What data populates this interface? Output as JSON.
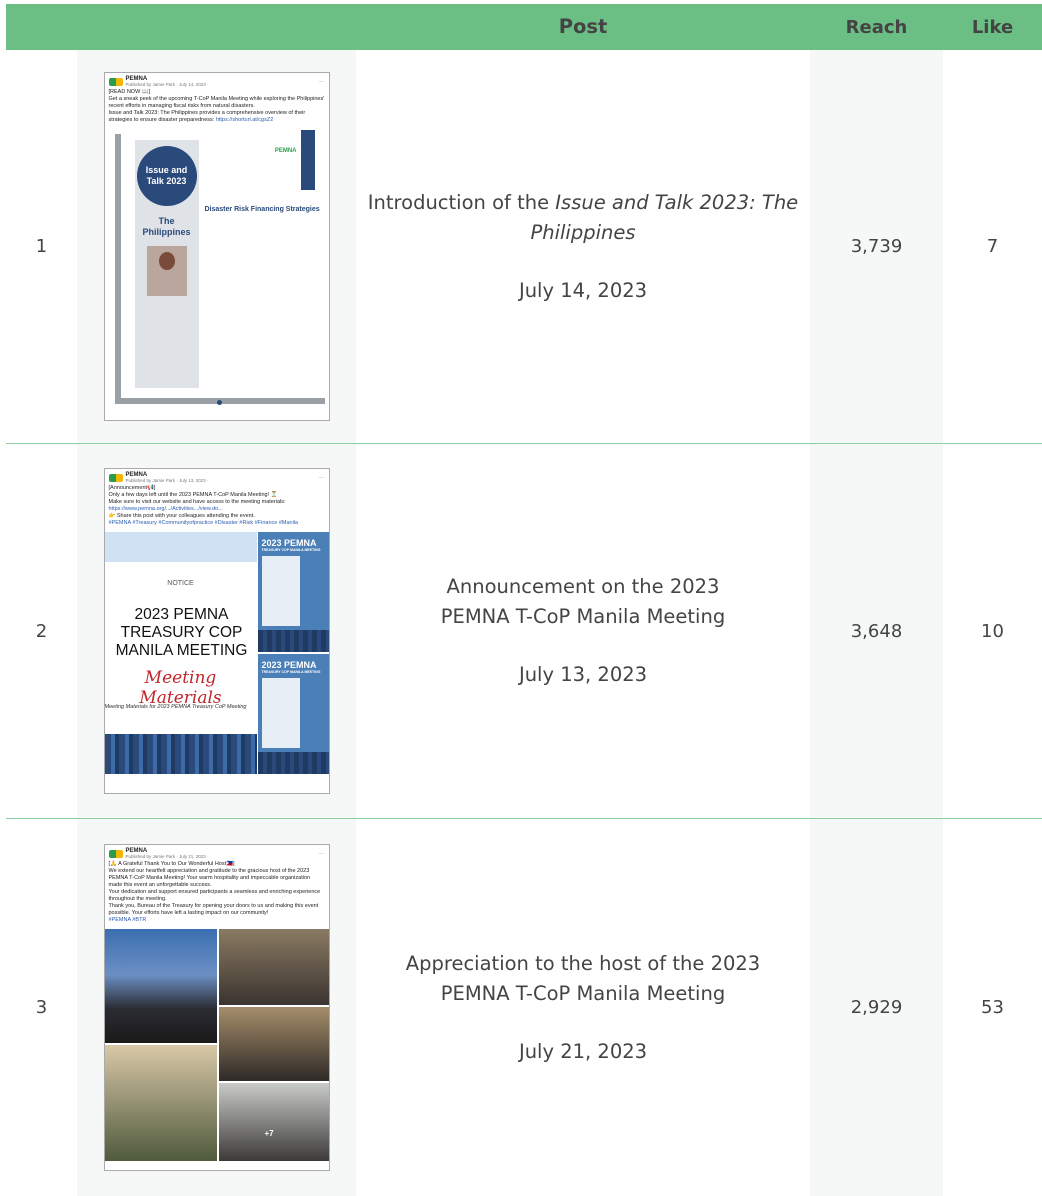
{
  "table": {
    "headers": {
      "post": "Post",
      "reach": "Reach",
      "like": "Like"
    },
    "rows": [
      {
        "num": "1",
        "title_plain": "Introduction of the ",
        "title_italic": "Issue and Talk 2023: The Philippines",
        "date": "July 14, 2023",
        "reach": "3,739",
        "like": "7",
        "thumb": {
          "page": "PEMNA",
          "published": "Published by Jamie Park · July 14, 2023 ·",
          "lines": [
            "[READ NOW 📖]",
            "Get a sneak peek of the upcoming T-CoP Manila Meeting while exploring the Philippines' recent efforts in managing fiscal risks from natural disasters.",
            "Issue and Talk 2023: The Philippines provides a comprehensive overview of their strategies to ensure disaster preparedness:"
          ],
          "link": "https://shorturl.at/cgsZ2",
          "doc_title": "Issue and Talk 2023",
          "doc_country": "The Philippines",
          "doc_heading": "Disaster Risk Financing Strategies",
          "doc_logo": "PEMNA"
        }
      },
      {
        "num": "2",
        "title_line1": "Announcement on the 2023",
        "title_line2": "PEMNA T-CoP Manila Meeting",
        "date": "July 13, 2023",
        "reach": "3,648",
        "like": "10",
        "thumb": {
          "page": "PEMNA",
          "published": "Published by Jamie Park · July 13, 2023 ·",
          "lines": [
            "[Announcement📢]",
            "Only a few days left until the 2023 PEMNA T-CoP Manila Meeting! ⏳",
            "Make sure to visit our website and have access to the meeting materials:"
          ],
          "link": "https://www.pemna.org/.../Activities.../view.do...",
          "share": "👉 Share this post with your colleagues attending the event.",
          "tags": "#PEMNA #Treasury #Communityofpractice #Disaster #Risk #Finance #Manila",
          "notice": "NOTICE",
          "big": "2023 PEMNA TREASURY COP MANILA MEETING",
          "script": "Meeting Materials",
          "foot": "Meeting Materials for 2023 PEMNA Treasury CoP Meeting",
          "side_title": "2023 PEMNA",
          "side_sub": "TREASURY COP MANILA MEETING"
        }
      },
      {
        "num": "3",
        "title_line1": "Appreciation to the host of the 2023",
        "title_line2": "PEMNA T-CoP Manila Meeting",
        "date": "July 21, 2023",
        "reach": "2,929",
        "like": "53",
        "thumb": {
          "page": "PEMNA",
          "published": "Published by Jamie Park · July 21, 2023 ·",
          "lines": [
            "[🙏 A Grateful Thank You to Our Wonderful Host🇵🇭]",
            "We extend our heartfelt appreciation and gratitude to the gracious host of the 2023 PEMNA T-CoP Manila Meeting! Your warm hospitality and impeccable organization made this event an unforgettable success.",
            "Your dedication and support ensured participants a seamless and enriching experience throughout the meeting.",
            "Thank you, Bureau of the Treasury for opening your doors to us and making this event possible. Your efforts have left a lasting impact on our community!"
          ],
          "tags": "#PEMNA #BTR",
          "more": "+7"
        }
      }
    ]
  }
}
